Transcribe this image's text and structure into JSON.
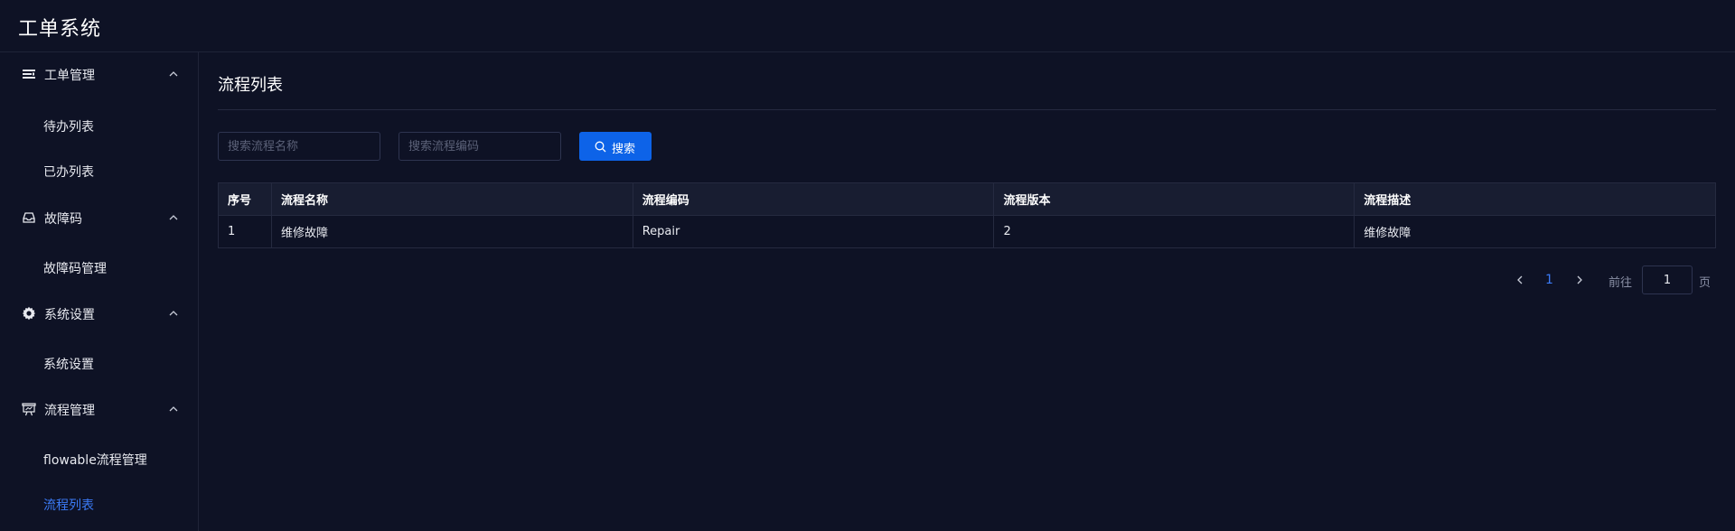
{
  "app": {
    "title": "工单系统"
  },
  "sidebar": {
    "groups": [
      {
        "label": "工单管理",
        "icon": "list-icon",
        "items": [
          {
            "label": "待办列表"
          },
          {
            "label": "已办列表"
          }
        ]
      },
      {
        "label": "故障码",
        "icon": "inbox-icon",
        "items": [
          {
            "label": "故障码管理"
          }
        ]
      },
      {
        "label": "系统设置",
        "icon": "gear-icon",
        "items": [
          {
            "label": "系统设置"
          }
        ]
      },
      {
        "label": "流程管理",
        "icon": "presentation-icon",
        "items": [
          {
            "label": "flowable流程管理"
          },
          {
            "label": "流程列表"
          }
        ]
      }
    ],
    "active_item": "流程列表"
  },
  "main": {
    "title": "流程列表",
    "search": {
      "name_placeholder": "搜索流程名称",
      "name_value": "",
      "code_placeholder": "搜索流程编码",
      "code_value": "",
      "button_label": "搜索"
    },
    "table": {
      "columns": [
        "序号",
        "流程名称",
        "流程编码",
        "流程版本",
        "流程描述"
      ],
      "rows": [
        [
          "1",
          "维修故障",
          "Repair",
          "2",
          "维修故障"
        ]
      ]
    },
    "pagination": {
      "current_page": "1",
      "goto_label": "前往",
      "goto_value": "1",
      "page_label": "页"
    }
  },
  "colors": {
    "background": "#0e1225",
    "accent": "#0d63e8",
    "active_text": "#3b7bf6",
    "border": "#252a40"
  }
}
